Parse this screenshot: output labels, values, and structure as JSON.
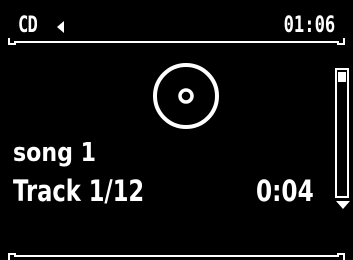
{
  "status": {
    "source": "CD",
    "clock": "01:06"
  },
  "player": {
    "song_title": "song 1",
    "track": "Track 1/12",
    "elapsed": "0:04"
  },
  "icons": {
    "speaker": "speaker-icon",
    "disc": "disc-icon",
    "scroll_down": "scroll-down-arrow-icon"
  },
  "scrollbar": {
    "position_fraction": 0.0
  },
  "colors": {
    "background": "#000000",
    "foreground": "#ffffff"
  }
}
